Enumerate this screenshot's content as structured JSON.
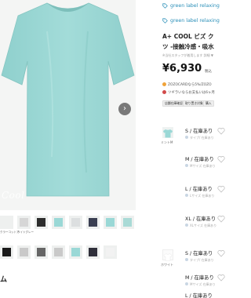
{
  "product": {
    "brand_links": [
      "green label relaxing",
      "green label relaxing"
    ],
    "title_lines": [
      "A+ COOL ビズ ク",
      "ツ -接触冷感・吸水"
    ],
    "note": "※当社スタッフが着用します 詳細 ▼",
    "price": "¥6,930",
    "tax": "税込",
    "points": [
      {
        "text": "ZOZOCARDなら5%/ZOZO",
        "color": "#f0a33a"
      },
      {
        "text": "ツギラいならお支払いは6ヶ月",
        "color": "#d24b4b"
      }
    ],
    "pills": [
      "店舗在庫確認",
      "取り置き対象",
      "購入"
    ]
  },
  "gallery": {
    "watermark": "Cool",
    "next_button": "›",
    "thumbs_row1": [
      {
        "color": "#eef0ef",
        "label": "クラーコットア"
      },
      {
        "color": "#d6d6d6",
        "label": "ライトグレー"
      },
      {
        "color": "#2d2d2d",
        "label": ""
      },
      {
        "color": "#9ad8d6",
        "label": ""
      },
      {
        "color": "#dcdfe0",
        "label": ""
      },
      {
        "color": "#3a3f52",
        "label": ""
      },
      {
        "color": "#9ad8d6",
        "label": ""
      },
      {
        "color": "#a9dad6",
        "label": ""
      },
      {
        "color": "#9ad8d6",
        "label": ""
      }
    ],
    "thumbs_row2": [
      {
        "color": "#1a1a1a",
        "label": ""
      },
      {
        "color": "#c9c9c9",
        "label": ""
      },
      {
        "color": "#666666",
        "label": ""
      },
      {
        "color": "#c9c9c9",
        "label": ""
      },
      {
        "color": "#9ad8d6",
        "label": ""
      },
      {
        "color": "#2f2f3a",
        "label": ""
      },
      {
        "color": "#f2f2f2",
        "label": ""
      }
    ],
    "section_heading": "ム"
  },
  "colors": [
    {
      "name": "ミントM",
      "swatch": "#9ad8d6"
    },
    {
      "name": "ホワイト",
      "swatch": "#ffffff"
    }
  ],
  "sizes_color1": [
    {
      "label": "S / 在庫あり",
      "sub": "タイプ/ 在庫あり"
    },
    {
      "label": "M / 在庫あり",
      "sub": "Mサイズ 在庫あり"
    },
    {
      "label": "L / 在庫あり",
      "sub": "Lサイズ 在庫あり"
    },
    {
      "label": "XL / 在庫あり",
      "sub": "XLサイズ 在庫あり"
    }
  ],
  "sizes_color2": [
    {
      "label": "S / 在庫あり",
      "sub": "タイプ/ 在庫あり"
    },
    {
      "label": "M / 在庫あり",
      "sub": "Mサイズ 在庫あり"
    },
    {
      "label": "L / 在庫あり",
      "sub": ""
    }
  ],
  "theme": {
    "accent": "#2a8fb8",
    "mint": "#9ad8d6",
    "heart": "#c0c0c0"
  }
}
